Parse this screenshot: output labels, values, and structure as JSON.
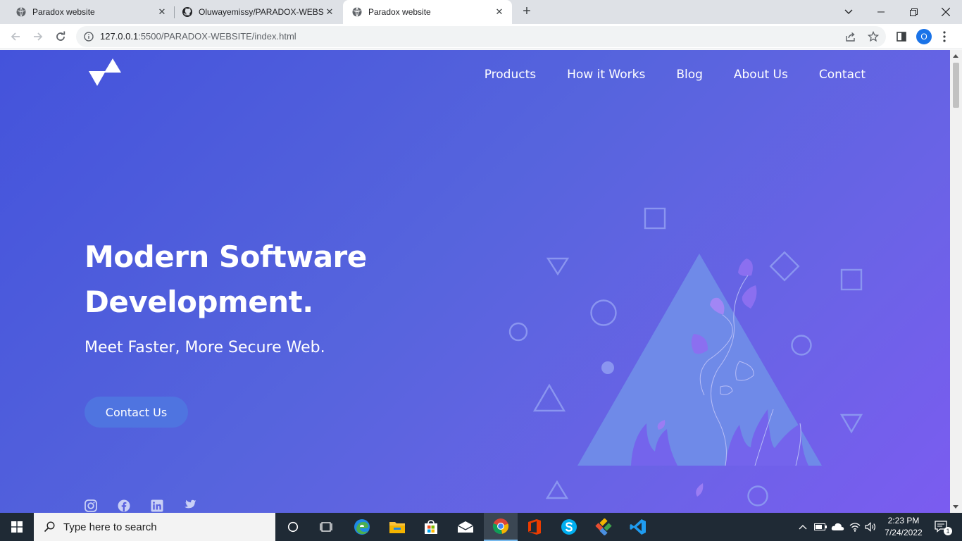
{
  "browser": {
    "tabs": [
      {
        "title": "Paradox website",
        "active": false
      },
      {
        "title": "Oluwayemissy/PARADOX-WEBSITE",
        "active": false
      },
      {
        "title": "Paradox website",
        "active": true
      }
    ],
    "url_host": "127.0.0.1",
    "url_rest": ":5500/PARADOX-WEBSITE/index.html",
    "profile_initial": "O"
  },
  "site": {
    "nav": [
      "Products",
      "How it Works",
      "Blog",
      "About Us",
      "Contact"
    ],
    "hero": {
      "title_line1": "Modern Software",
      "title_line2": "Development.",
      "subtitle": "Meet Faster, More Secure Web.",
      "cta_label": "Contact Us"
    },
    "socials": [
      "instagram-icon",
      "facebook-icon",
      "linkedin-icon",
      "twitter-icon"
    ]
  },
  "taskbar": {
    "search_placeholder": "Type here to search",
    "time": "2:23 PM",
    "date": "7/24/2022",
    "notification_count": "1",
    "apps": [
      "cortana-icon",
      "task-view-icon",
      "edge-icon",
      "file-explorer-icon",
      "store-icon",
      "mail-icon",
      "chrome-icon",
      "office-icon",
      "skype-icon",
      "git-icon",
      "vscode-icon"
    ]
  },
  "colors": {
    "hero_gradient_start": "#4453db",
    "hero_gradient_end": "#7b5cf0",
    "cta_background": "#4f74e0",
    "taskbar": "#1f2a35"
  }
}
